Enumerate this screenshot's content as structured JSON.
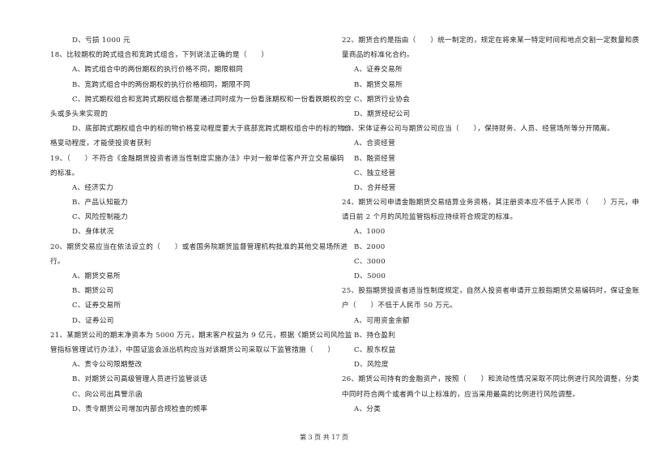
{
  "left_column": [
    {
      "text": "D、亏损 1000 元",
      "opt": true
    },
    {
      "text": "18、比较期权的跨式组合和宽跨式组合，下列说法正确的是（　　）",
      "opt": false
    },
    {
      "text": "A、跨式组合中的两份期权的执行价格不同，期限相同",
      "opt": true
    },
    {
      "text": "B、宽跨式组合中的两份期权的执行价格相同，期限不同",
      "opt": true
    },
    {
      "text": "C、跨式期权组合和宽跨式期权组合都是通过同时成为一份看涨期权和一份看跌期权的空",
      "opt": true
    },
    {
      "text": "头或多头来实现的",
      "opt": false
    },
    {
      "text": "D、底部跨式期权组合中的标的物价格变动程度要大于底部宽跨式期权组合中的标的物价",
      "opt": true
    },
    {
      "text": "格变动程度，才能使投资者获利",
      "opt": false
    },
    {
      "text": "19、（　　）不符合《金融期货投资者适当性制度实施办法》中对一般单位客户开立交易编码",
      "opt": false
    },
    {
      "text": "的标准。",
      "opt": false
    },
    {
      "text": "A、经济实力",
      "opt": true
    },
    {
      "text": "B、产品认知能力",
      "opt": true
    },
    {
      "text": "C、风险控制能力",
      "opt": true
    },
    {
      "text": "D、身体状况",
      "opt": true
    },
    {
      "text": "20、期货交易应当在依法设立的（　　）或者国务院期货监督管理机构批准的其他交易场所进",
      "opt": false
    },
    {
      "text": "行。",
      "opt": false
    },
    {
      "text": "A、期货交易所",
      "opt": true
    },
    {
      "text": "B、期货公司",
      "opt": true
    },
    {
      "text": "C、证券交易所",
      "opt": true
    },
    {
      "text": "D、证券公司",
      "opt": true
    },
    {
      "text": "21、某期货公司的期末净资本为 5000 万元，期末客户权益为 9 亿元，根据《期货公司风险监",
      "opt": false
    },
    {
      "text": "管指标管理试行办法》，中国证监会派出机构应当对该期货公司采取以下监管措施（　　）",
      "opt": false
    },
    {
      "text": "A、责令公司限期整改",
      "opt": true
    },
    {
      "text": "B、对期货公司高级管理人员进行监管谈话",
      "opt": true
    },
    {
      "text": "C、向公司出具警示函",
      "opt": true
    },
    {
      "text": "D、责令期货公司增加内部合规检查的频率",
      "opt": true
    }
  ],
  "right_column": [
    {
      "text": "22、期货合约是指由（　　）统一制定的，规定在将来某一特定时间和地点交割一定数量和质",
      "opt": false
    },
    {
      "text": "量商品的标准化合约。",
      "opt": false
    },
    {
      "text": "A、证券交易所",
      "opt": true
    },
    {
      "text": "B、期货交易所",
      "opt": true
    },
    {
      "text": "C、期货行业协会",
      "opt": true
    },
    {
      "text": "D、期货经纪公司",
      "opt": true
    },
    {
      "text": "23、宋体证券公司与期货公司应当（　　），保持财务、人员、经营场所等分开隔离。",
      "opt": false
    },
    {
      "text": "A、合资经营",
      "opt": true
    },
    {
      "text": "B、融资经营",
      "opt": true
    },
    {
      "text": "C、独立经营",
      "opt": true
    },
    {
      "text": "D、合并经营",
      "opt": true
    },
    {
      "text": "24、期货公司申请金融期货交易结算业务资格，其注册资本应不低于人民币（　　）万元，申",
      "opt": false
    },
    {
      "text": "请日前 2 个月的风险监管指标应持续符合规定的标准。",
      "opt": false
    },
    {
      "text": "A、1000",
      "opt": true
    },
    {
      "text": "B、2000",
      "opt": true
    },
    {
      "text": "C、3000",
      "opt": true
    },
    {
      "text": "D、5000",
      "opt": true
    },
    {
      "text": "25、股指期货投资者适当性制度规定，自然人投资者申请开立股指期货交易编码时，保证金账",
      "opt": false
    },
    {
      "text": "户（　　）不低于人民币 50 万元。",
      "opt": false
    },
    {
      "text": "A、可用资金余额",
      "opt": true
    },
    {
      "text": "B、持仓盈利",
      "opt": true
    },
    {
      "text": "C、股东权益",
      "opt": true
    },
    {
      "text": "D、风险度",
      "opt": true
    },
    {
      "text": "26、期货公司持有的金融资产，按照（　　）和流动性情况采取不同比例进行风险调整，分类",
      "opt": false
    },
    {
      "text": "中同时符合两个或者两个以上标准的，应当采用最高的比例进行风险调整。",
      "opt": false
    },
    {
      "text": "A、分类",
      "opt": true
    }
  ],
  "footer": "第 3 页 共 17 页"
}
